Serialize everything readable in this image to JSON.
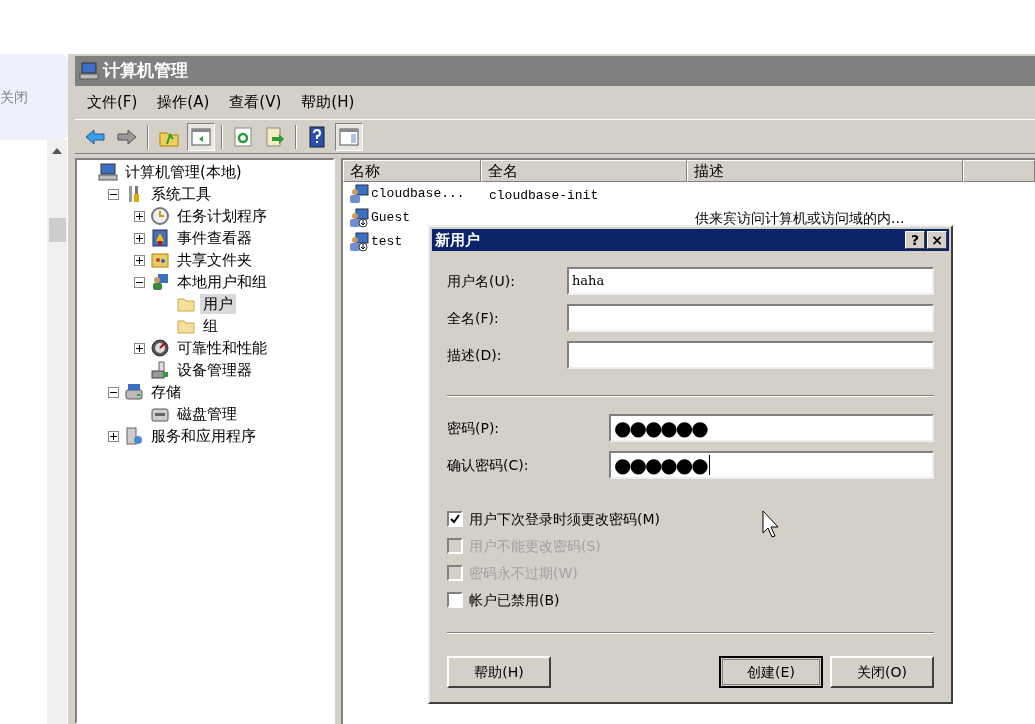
{
  "background": {
    "close_link": "关闭"
  },
  "window": {
    "title": "计算机管理"
  },
  "menu": [
    "文件(F)",
    "操作(A)",
    "查看(V)",
    "帮助(H)"
  ],
  "toolbar": [
    {
      "kind": "back",
      "pressed": false
    },
    {
      "kind": "forward",
      "pressed": false
    },
    {
      "kind": "sep"
    },
    {
      "kind": "up",
      "pressed": false
    },
    {
      "kind": "tree",
      "pressed": true
    },
    {
      "kind": "sep"
    },
    {
      "kind": "refresh",
      "pressed": false
    },
    {
      "kind": "export",
      "pressed": false
    },
    {
      "kind": "sep"
    },
    {
      "kind": "help",
      "pressed": false
    },
    {
      "kind": "pane",
      "pressed": true
    }
  ],
  "tree": [
    {
      "label": "计算机管理(本地)",
      "kind": "computer",
      "selected": false,
      "children": [
        {
          "label": "系统工具",
          "kind": "tools",
          "expanded": true,
          "selected": false,
          "children": [
            {
              "label": "任务计划程序",
              "kind": "clock",
              "expanded": false,
              "selected": false
            },
            {
              "label": "事件查看器",
              "kind": "event",
              "expanded": false,
              "selected": false
            },
            {
              "label": "共享文件夹",
              "kind": "share",
              "expanded": false,
              "selected": false
            },
            {
              "label": "本地用户和组",
              "kind": "users",
              "expanded": true,
              "selected": false,
              "children": [
                {
                  "label": "用户",
                  "kind": "folder",
                  "selected": true
                },
                {
                  "label": "组",
                  "kind": "folder",
                  "selected": false
                }
              ]
            },
            {
              "label": "可靠性和性能",
              "kind": "perf",
              "expanded": false,
              "selected": false
            },
            {
              "label": "设备管理器",
              "kind": "device",
              "selected": false
            }
          ]
        },
        {
          "label": "存储",
          "kind": "storage",
          "expanded": true,
          "selected": false,
          "children": [
            {
              "label": "磁盘管理",
              "kind": "disk",
              "selected": false
            }
          ]
        },
        {
          "label": "服务和应用程序",
          "kind": "services",
          "expanded": false,
          "selected": false
        }
      ]
    }
  ],
  "table": {
    "columns": [
      "名称",
      "全名",
      "描述"
    ],
    "rows": [
      {
        "name": "cloudbase...",
        "full_name": "cloudbase-init",
        "kind": "user"
      },
      {
        "name": "Guest",
        "description": "供来宾访问计算机或访问域的内...",
        "kind": "user-down"
      },
      {
        "name": "test",
        "kind": "user-down"
      }
    ]
  },
  "dialog": {
    "title": "新用户",
    "title_buttons": [
      "?",
      "×"
    ],
    "fields": [
      {
        "label": "用户名(U):",
        "value": "haha",
        "kind": "text"
      },
      {
        "label": "全名(F):",
        "kind": "text"
      },
      {
        "label": "描述(D):",
        "kind": "text"
      },
      {
        "label": "密码(P):",
        "value": "●●●●●●",
        "kind": "password"
      },
      {
        "label": "确认密码(C):",
        "value": "●●●●●●",
        "kind": "password",
        "focused": true
      }
    ],
    "checkboxes": [
      {
        "label": "用户下次登录时须更改密码(M)",
        "checked": true,
        "disabled": false
      },
      {
        "label": "用户不能更改密码(S)",
        "checked": false,
        "disabled": true
      },
      {
        "label": "密码永不过期(W)",
        "checked": false,
        "disabled": true
      },
      {
        "label": "帐户已禁用(B)",
        "checked": false,
        "disabled": false
      }
    ],
    "buttons": [
      {
        "label": "帮助(H)",
        "default": false
      },
      {
        "label": "创建(E)",
        "default": true
      },
      {
        "label": "关闭(O)",
        "default": false
      }
    ]
  }
}
